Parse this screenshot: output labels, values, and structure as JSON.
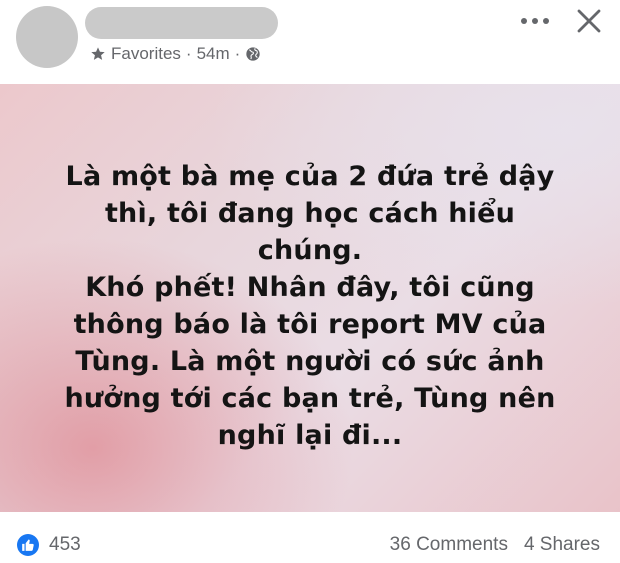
{
  "header": {
    "audience": "Favorites",
    "separator": "·",
    "time": "54m",
    "icons": [
      "star-icon",
      "globe-icon",
      "more-icon",
      "close-icon"
    ]
  },
  "post": {
    "text": "Là một bà mẹ của 2 đứa trẻ dậy\nthì, tôi đang học cách hiểu chúng.\nKhó phết! Nhân đây, tôi cũng\nthông báo là tôi report MV của\nTùng. Là một người có sức ảnh\nhưởng tới các bạn trẻ, Tùng nên\nnghĩ lại đi..."
  },
  "footer": {
    "likes": "453",
    "comments": "36 Comments",
    "shares": "4 Shares"
  },
  "colors": {
    "like_blue": "#1877f2",
    "meta_gray": "#65676b"
  }
}
